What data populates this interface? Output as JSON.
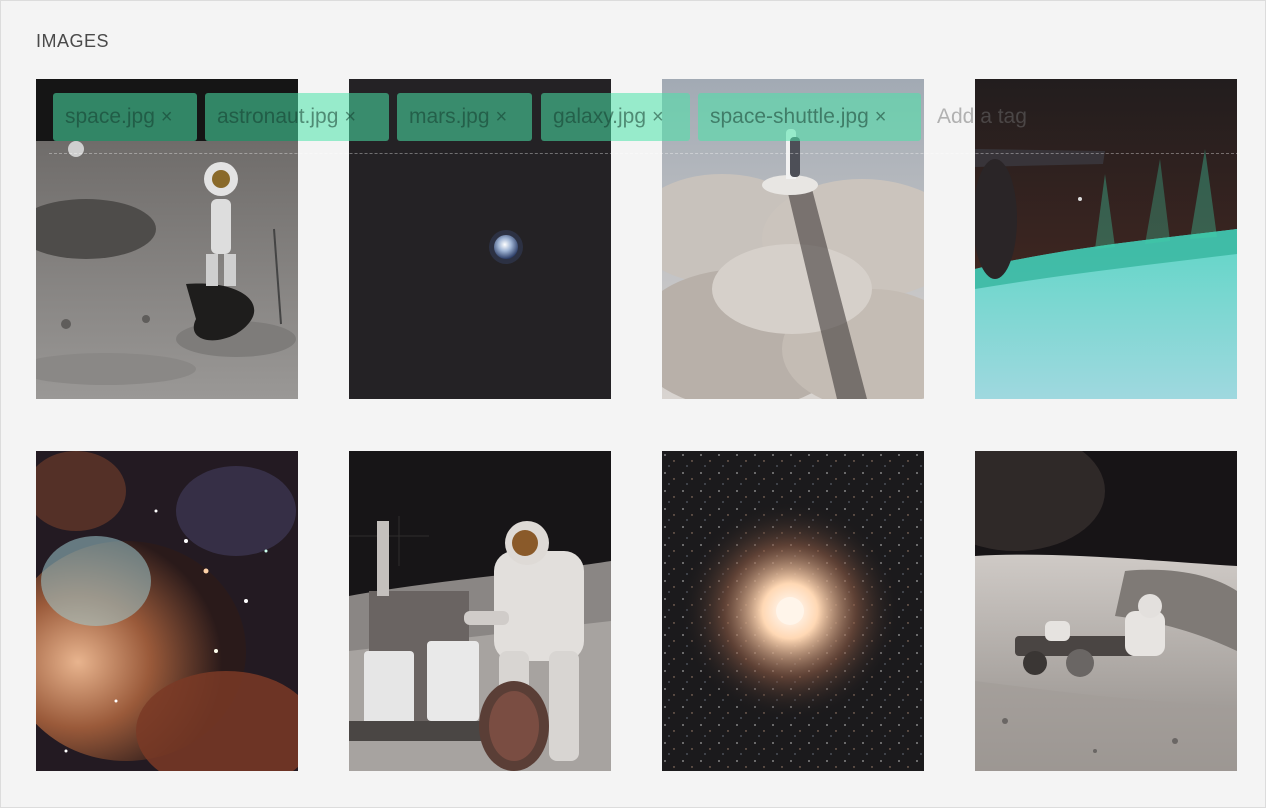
{
  "section": {
    "title": "IMAGES"
  },
  "tag_input": {
    "tags": [
      {
        "label": "space.jpg",
        "remove": "×"
      },
      {
        "label": "astronaut.jpg",
        "remove": "×"
      },
      {
        "label": "mars.jpg",
        "remove": "×"
      },
      {
        "label": "galaxy.jpg",
        "remove": "×"
      },
      {
        "label": "space-shuttle.jpg",
        "remove": "×"
      }
    ],
    "placeholder": "Add a tag"
  },
  "colors": {
    "tag_background": "#4be3aa",
    "page_background": "#f4f4f4",
    "title_text": "#4a4a4a"
  },
  "gallery": {
    "images": [
      {
        "subject": "astronaut-on-moon"
      },
      {
        "subject": "earth-from-space"
      },
      {
        "subject": "shuttle-above-clouds"
      },
      {
        "subject": "aurora-from-orbit"
      },
      {
        "subject": "nebula"
      },
      {
        "subject": "astronaut-with-equipment"
      },
      {
        "subject": "star-cluster"
      },
      {
        "subject": "lunar-rover"
      }
    ]
  }
}
